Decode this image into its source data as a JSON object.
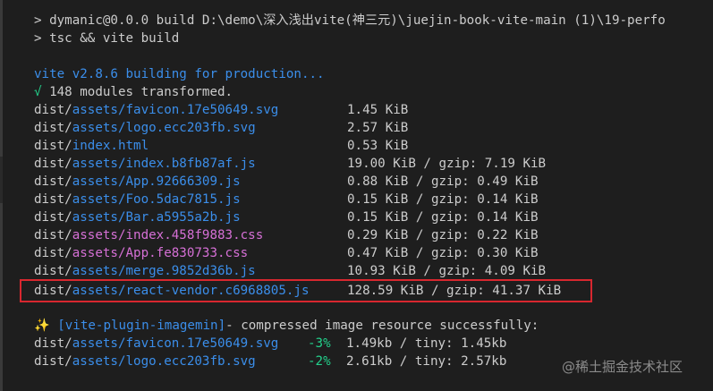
{
  "terminal": {
    "prompt_lines": [
      "> dymanic@0.0.0 build D:\\demo\\深入浅出vite(神三元)\\juejin-book-vite-main (1)\\19-perfo",
      "> tsc && vite build"
    ],
    "building": "vite v2.8.6 building for production...",
    "transformed_check": "√",
    "transformed_text": " 148 modules transformed.",
    "files": [
      {
        "prefix": "dist/",
        "path": "assets/favicon.17e50649.svg",
        "type": "svg",
        "size": "1.45 KiB"
      },
      {
        "prefix": "dist/",
        "path": "assets/logo.ecc203fb.svg",
        "type": "svg",
        "size": "2.57 KiB"
      },
      {
        "prefix": "dist/",
        "path": "index.html",
        "type": "html",
        "size": "0.53 KiB"
      },
      {
        "prefix": "dist/",
        "path": "assets/index.b8fb87af.js",
        "type": "js",
        "size": "19.00 KiB / gzip: 7.19 KiB"
      },
      {
        "prefix": "dist/",
        "path": "assets/App.92666309.js",
        "type": "js",
        "size": "0.88 KiB / gzip: 0.49 KiB"
      },
      {
        "prefix": "dist/",
        "path": "assets/Foo.5dac7815.js",
        "type": "js",
        "size": "0.15 KiB / gzip: 0.14 KiB"
      },
      {
        "prefix": "dist/",
        "path": "assets/Bar.a5955a2b.js",
        "type": "js",
        "size": "0.15 KiB / gzip: 0.14 KiB"
      },
      {
        "prefix": "dist/",
        "path": "assets/index.458f9883.css",
        "type": "css",
        "size": "0.29 KiB / gzip: 0.22 KiB"
      },
      {
        "prefix": "dist/",
        "path": "assets/App.fe830733.css",
        "type": "css",
        "size": "0.47 KiB / gzip: 0.30 KiB"
      },
      {
        "prefix": "dist/",
        "path": "assets/merge.9852d36b.js",
        "type": "js",
        "size": "10.93 KiB / gzip: 4.09 KiB"
      },
      {
        "prefix": "dist/",
        "path": "assets/react-vendor.c6968805.js",
        "type": "js",
        "size": "128.59 KiB / gzip: 41.37 KiB"
      }
    ],
    "plugin_sparkle": "✨",
    "plugin_name": " [vite-plugin-imagemin]",
    "plugin_message": "- compressed image resource successfully:",
    "images": [
      {
        "prefix": "dist/",
        "path": "assets/favicon.17e50649.svg",
        "ratio": "-3%",
        "size": "1.49kb / tiny: 1.45kb"
      },
      {
        "prefix": "dist/",
        "path": "assets/logo.ecc203fb.svg",
        "ratio": "-2%",
        "size": "2.61kb / tiny: 2.57kb"
      }
    ]
  },
  "watermark": "@稀土掘金技术社区",
  "colors": {
    "background": "#1e1e1e",
    "text": "#cccccc",
    "path": "#3b8eea",
    "css_path": "#d670d6",
    "success": "#23d18b",
    "highlight_border": "#d8272f"
  }
}
